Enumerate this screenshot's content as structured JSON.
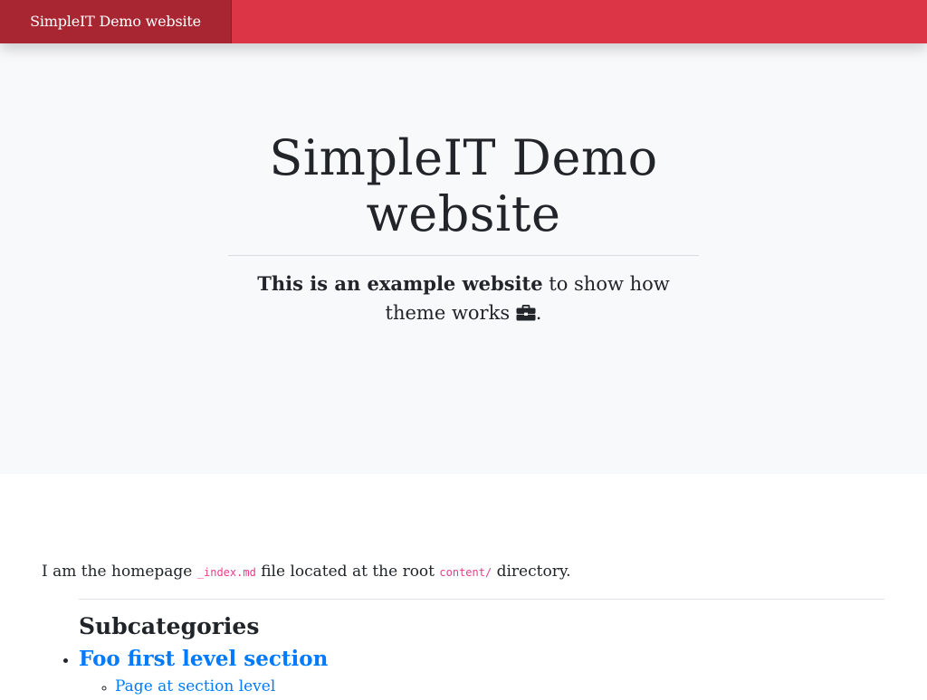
{
  "navbar": {
    "brand": "SimpleIT Demo website",
    "background_color": "#dc3545",
    "brand_background_color": "#a72632"
  },
  "hero": {
    "title": "SimpleIT Demo website",
    "lead_bold": "This is an example website",
    "lead_rest": " to show how theme works ",
    "lead_end": ".",
    "icon": "briefcase-icon"
  },
  "content": {
    "intro_prefix": "I am the homepage ",
    "intro_code_file": "_index.md",
    "intro_middle": " file located at the root ",
    "intro_code_dir": "content/",
    "intro_suffix": " directory.",
    "subcategories_heading": "Subcategories",
    "sections": [
      {
        "label": "Foo first level section",
        "pages": [
          {
            "label": "Page at section level"
          }
        ]
      }
    ],
    "link_color": "#007bff"
  }
}
